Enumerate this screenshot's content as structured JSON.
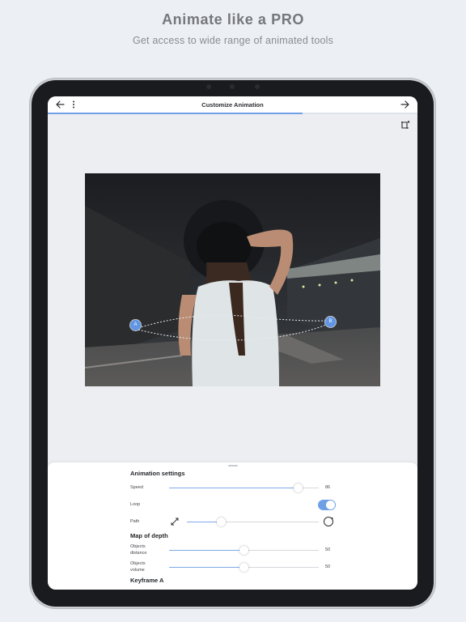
{
  "promo": {
    "headline": "Animate like a PRO",
    "subline": "Get access to wide range of animated tools"
  },
  "app": {
    "title": "Customize Animation",
    "progress_fraction": 0.69,
    "icons": {
      "back": "arrow-left-icon",
      "more": "more-vertical-icon",
      "next": "arrow-right-icon",
      "crop": "crop-icon"
    }
  },
  "canvas": {
    "point_a": "A",
    "point_b": "B"
  },
  "settings": {
    "animation_heading": "Animation settings",
    "speed": {
      "label": "Speed",
      "value": "86",
      "fraction": 0.86
    },
    "loop": {
      "label": "Loop",
      "on": true
    },
    "path": {
      "label": "Path",
      "fraction": 0.26
    },
    "depth_heading": "Map of depth",
    "distance": {
      "label_line1": "Objects",
      "label_line2": "distance",
      "value": "50",
      "fraction": 0.5
    },
    "volume": {
      "label_line1": "Objects",
      "label_line2": "volume",
      "value": "50",
      "fraction": 0.5
    },
    "keyframe_heading": "Keyframe A"
  },
  "colors": {
    "accent": "#6fa0e6",
    "background": "#eceff3"
  }
}
